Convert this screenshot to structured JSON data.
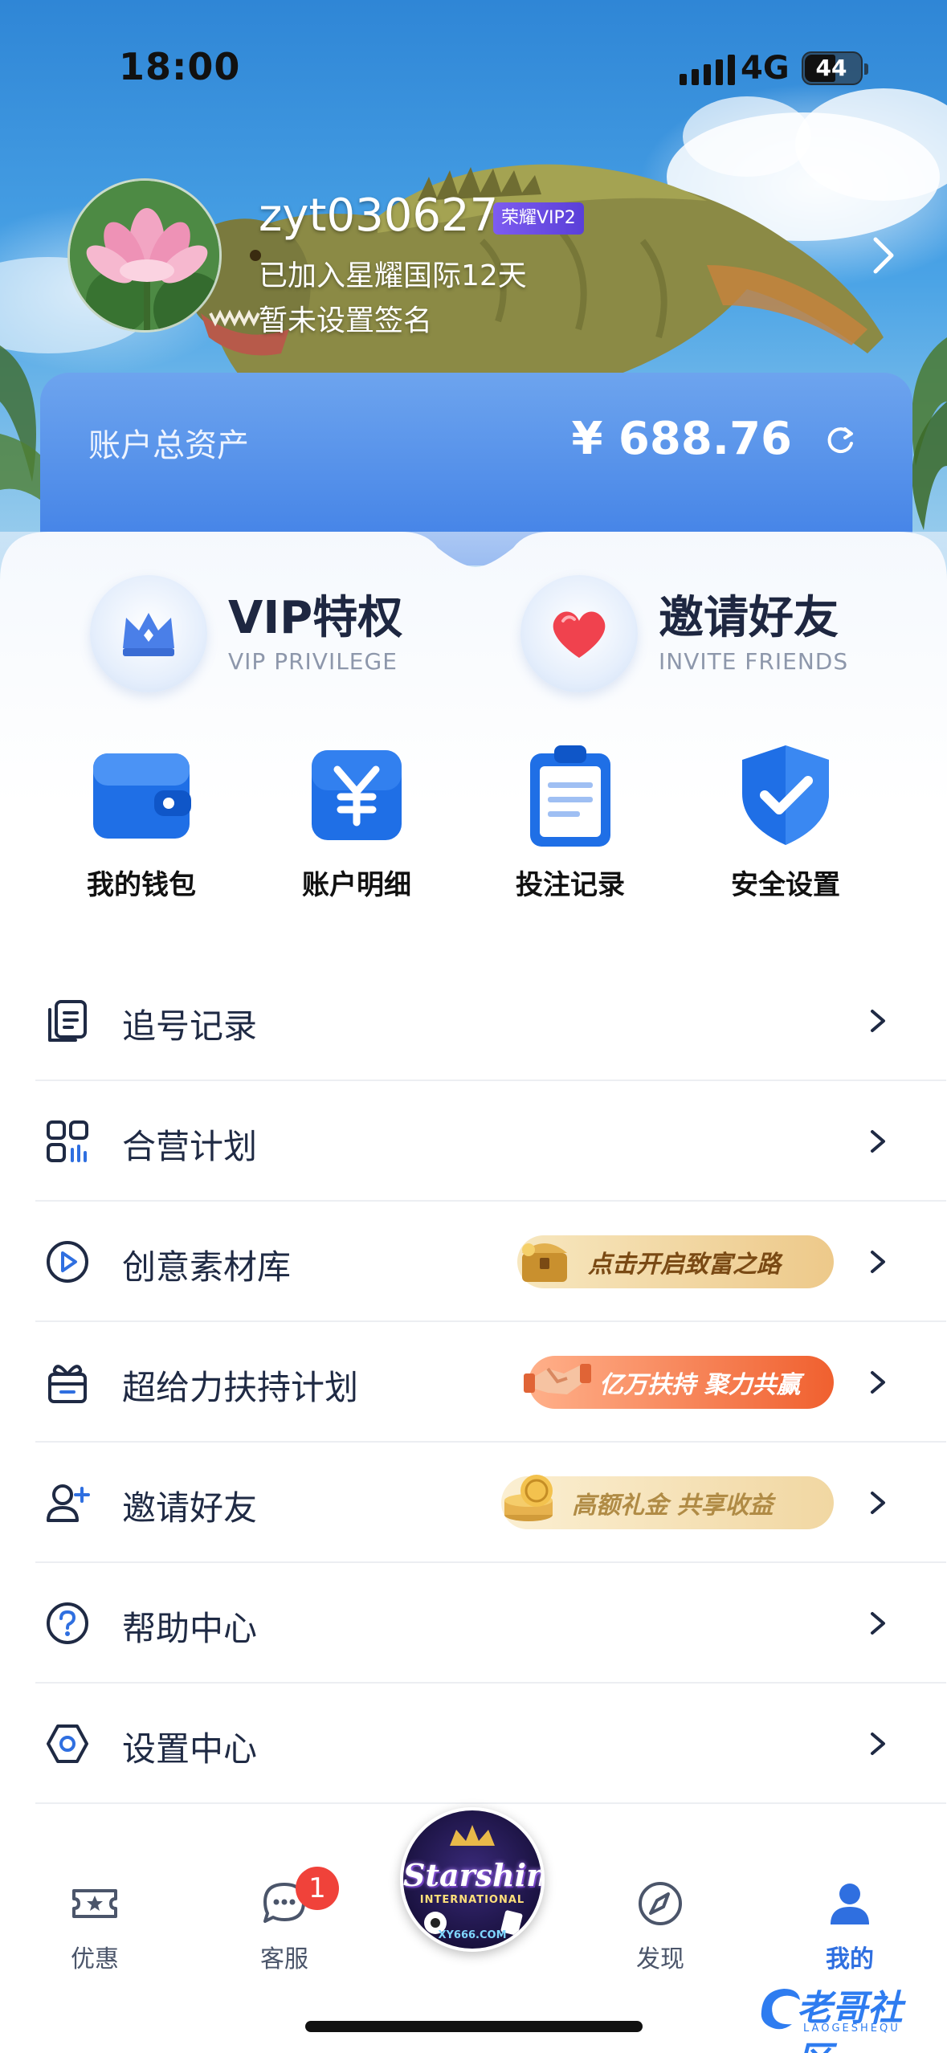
{
  "status_bar": {
    "time": "18:00",
    "network": "4G",
    "battery": "44"
  },
  "profile": {
    "username": "zyt030627",
    "vip_badge": "荣耀VIP2",
    "joined": "已加入星耀国际12天",
    "signature": "暂未设置签名"
  },
  "assets": {
    "label": "账户总资产",
    "value": "¥ 688.76"
  },
  "promos": [
    {
      "title": "VIP特权",
      "subtitle": "VIP PRIVILEGE",
      "icon": "crown-icon"
    },
    {
      "title": "邀请好友",
      "subtitle": "INVITE FRIENDS",
      "icon": "heart-icon"
    }
  ],
  "quick_actions": [
    {
      "label": "我的钱包",
      "icon": "wallet-icon"
    },
    {
      "label": "账户明细",
      "icon": "yen-icon"
    },
    {
      "label": "投注记录",
      "icon": "clipboard-icon"
    },
    {
      "label": "安全设置",
      "icon": "shield-check-icon"
    }
  ],
  "menu": [
    {
      "label": "追号记录",
      "icon": "records-icon"
    },
    {
      "label": "合营计划",
      "icon": "grid-chart-icon"
    },
    {
      "label": "创意素材库",
      "icon": "play-circle-icon",
      "banner": "点击开启致富之路"
    },
    {
      "label": "超给力扶持计划",
      "icon": "gift-box-icon",
      "banner": "亿万扶持 聚力共赢"
    },
    {
      "label": "邀请好友",
      "icon": "add-user-icon",
      "banner": "高额礼金 共享收益"
    },
    {
      "label": "帮助中心",
      "icon": "help-icon"
    },
    {
      "label": "设置中心",
      "icon": "hexagon-settings-icon"
    }
  ],
  "tabbar": {
    "tabs": [
      {
        "label": "优惠",
        "icon": "ticket-star-icon"
      },
      {
        "label": "客服",
        "icon": "chat-bubble-icon",
        "badge": "1"
      },
      {
        "label": "发现",
        "icon": "compass-icon"
      },
      {
        "label": "我的",
        "icon": "person-icon",
        "active": true
      }
    ],
    "center_logo": {
      "brand": "Starshine",
      "sub": "INTERNATIONAL",
      "domain": "XY666.COM"
    }
  },
  "watermark": {
    "text": "老哥社区",
    "sub": "LAOGESHEQU"
  },
  "colors": {
    "accent": "#3f7fe6",
    "badge": "#f0423a",
    "text": "#1f2a44"
  }
}
